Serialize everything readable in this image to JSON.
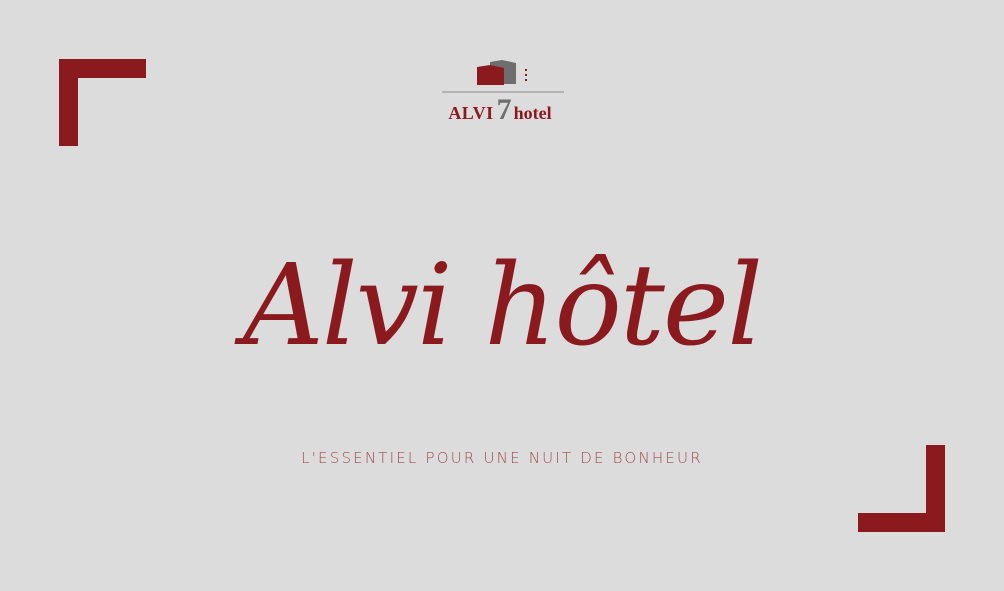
{
  "logo": {
    "brand_name": "ALVI",
    "number": "7",
    "suffix": "hotel"
  },
  "title": "Alvi hôtel",
  "tagline": "L'ESSENTIEL POUR UNE NUIT DE BONHEUR",
  "colors": {
    "background": "#dcdcdc",
    "accent": "#8b1a1f",
    "logo_gray": "#6e6e6e",
    "tagline": "#a24d50"
  },
  "icons": {
    "top_left": "corner-bracket-top-left",
    "bottom_right": "corner-bracket-bottom-right",
    "logo": "hotel-building-logo-icon"
  }
}
